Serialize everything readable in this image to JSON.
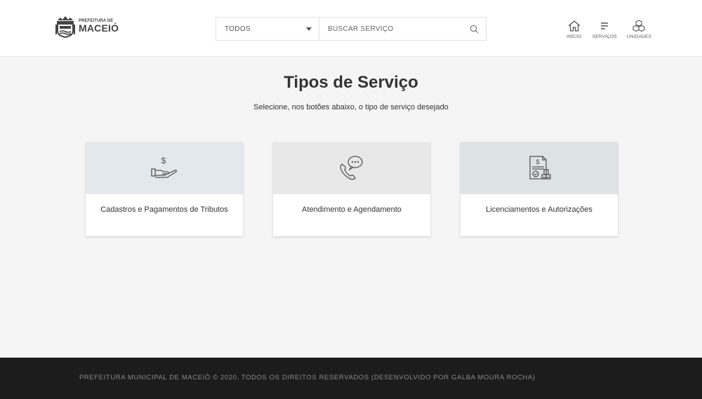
{
  "header": {
    "logo": {
      "small_text": "PREFEITURA DE",
      "big_text": "MACEIÓ"
    },
    "search": {
      "category_selected": "TODOS",
      "input_placeholder": "BUSCAR SERVIÇO",
      "input_value": ""
    },
    "nav": [
      {
        "label": "INÍCIO",
        "icon": "home-icon"
      },
      {
        "label": "SERVIÇOS",
        "icon": "menu-lines-icon"
      },
      {
        "label": "UNIDADES",
        "icon": "boxes-icon"
      }
    ]
  },
  "main": {
    "title": "Tipos de Serviço",
    "subtitle": "Selecione, nos botões abaixo, o tipo de serviço desejado",
    "cards": [
      {
        "label": "Cadastros e Pagamentos de Tributos",
        "icon": "hand-money-icon",
        "bg_color": "#e3e8ec"
      },
      {
        "label": "Atendimento e Agendamento",
        "icon": "phone-chat-icon",
        "bg_color": "#e8e8e8"
      },
      {
        "label": "Licenciamentos e Autorizações",
        "icon": "certificate-stamp-icon",
        "bg_color": "#dde2e5"
      }
    ]
  },
  "footer": {
    "text": "PREFEITURA MUNICIPAL DE MACEIÓ © 2020. TODOS OS DIREITOS RESERVADOS (DESENVOLVIDO POR GALBA MOURA ROCHA)"
  },
  "colors": {
    "header_bg": "#ffffff",
    "page_bg": "#f5f5f5",
    "footer_bg": "#1c1c1c",
    "text": "#333333"
  }
}
